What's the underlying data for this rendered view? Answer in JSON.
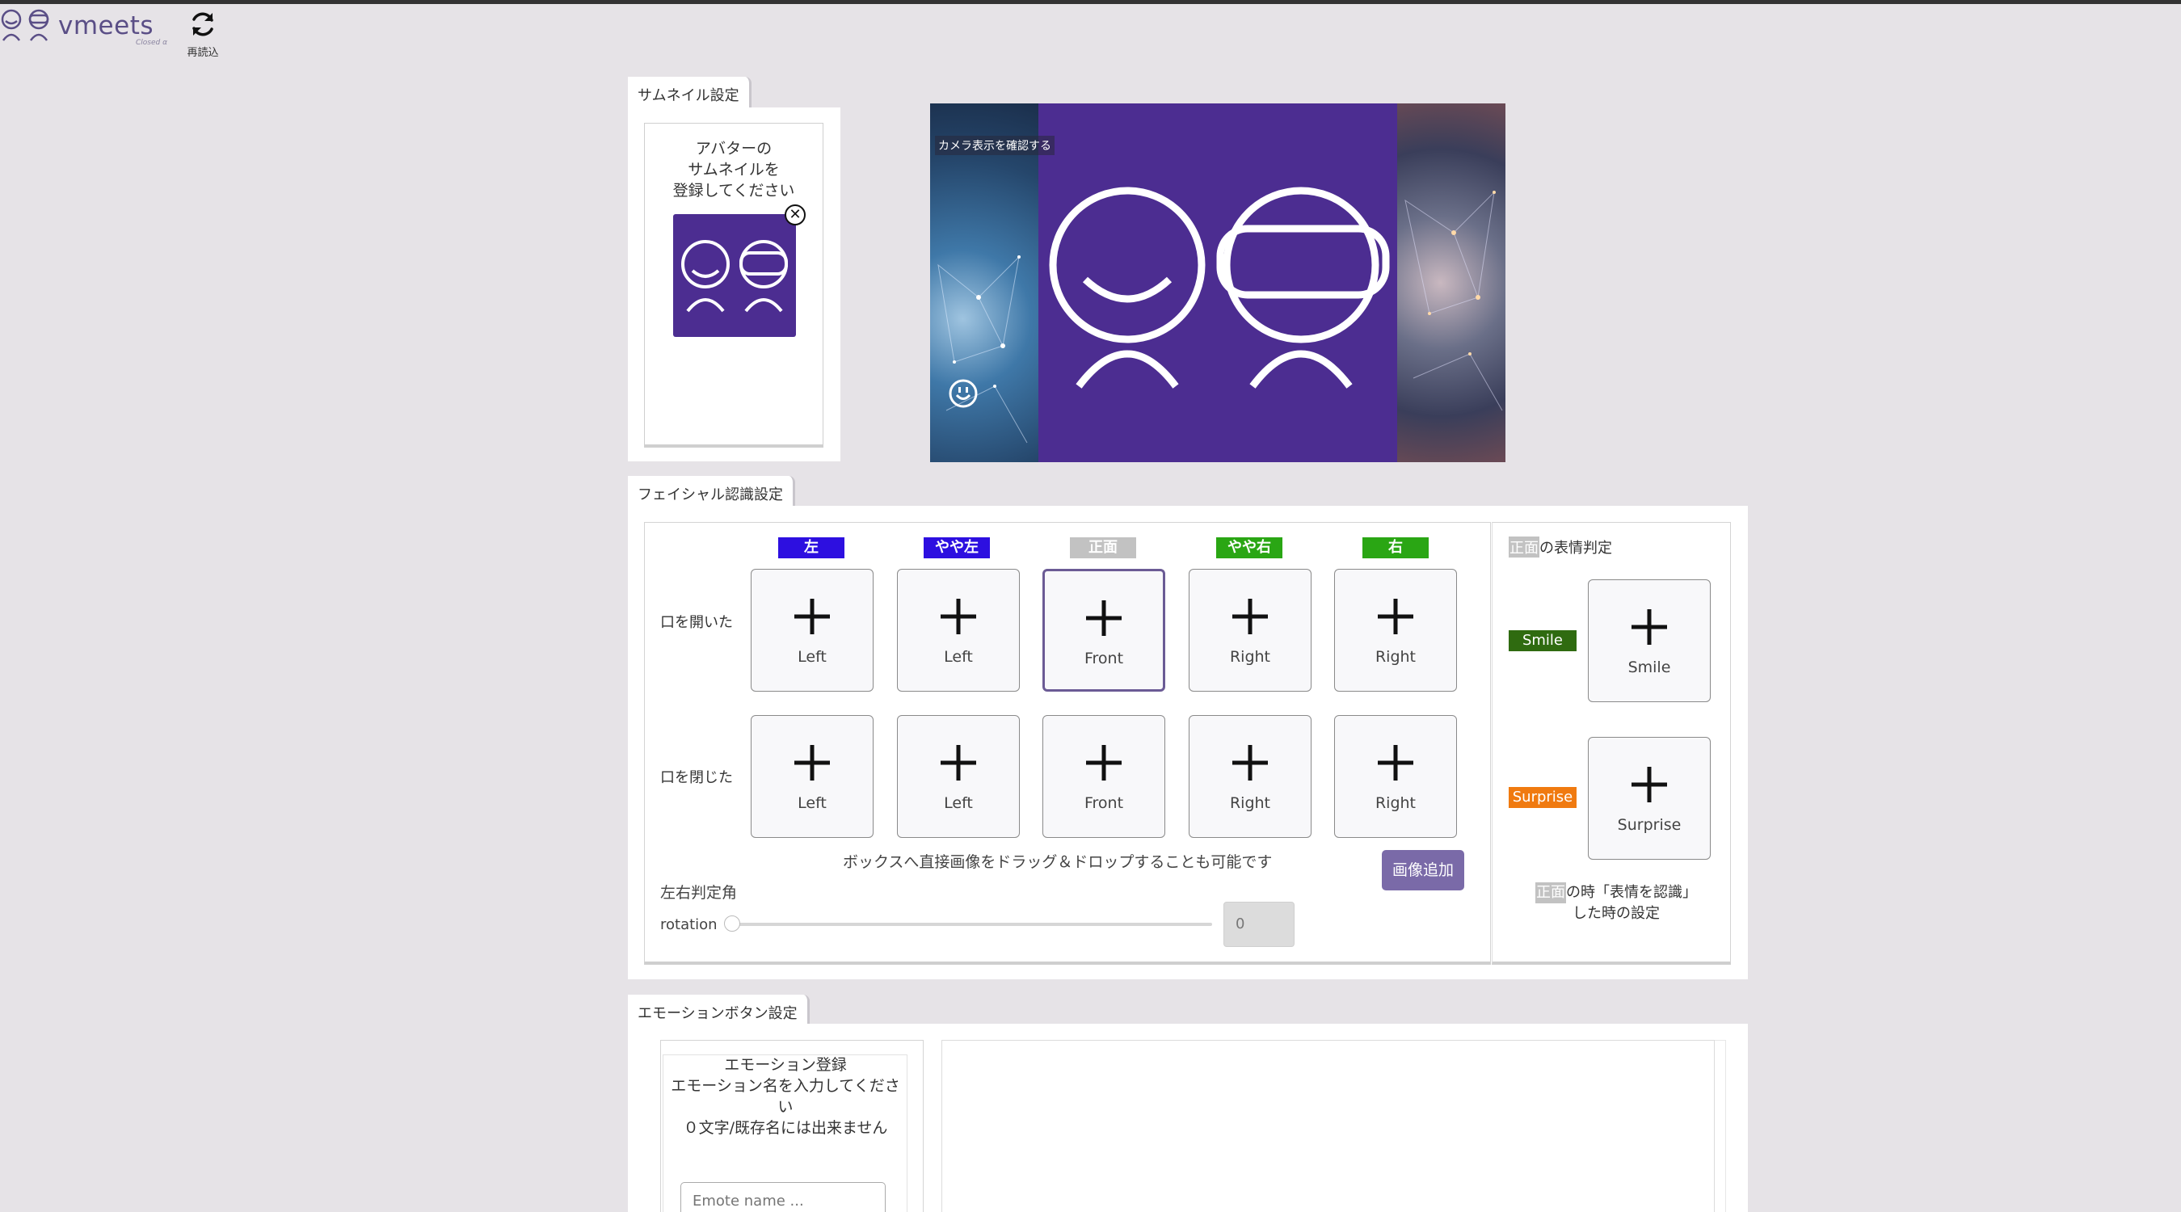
{
  "header": {
    "logo_text": "vmeets",
    "logo_sub": "Closed α",
    "reload_label": "再読込"
  },
  "thumbnail": {
    "tab_label": "サムネイル設定",
    "instruction_line1": "アバターの",
    "instruction_line2": "サムネイルを",
    "instruction_line3": "登録してください",
    "close_glyph": "✕"
  },
  "camera": {
    "label": "カメラ表示を確認する"
  },
  "facial": {
    "tab_label": "フェイシャル認識設定",
    "directions": [
      {
        "label": "左",
        "color": "#2d0fe0"
      },
      {
        "label": "やや左",
        "color": "#2d0fe0"
      },
      {
        "label": "正面",
        "color": "#c2c2c2"
      },
      {
        "label": "やや右",
        "color": "#2aa614"
      },
      {
        "label": "右",
        "color": "#2aa614"
      }
    ],
    "row_open": "口を開いた",
    "row_closed": "口を閉じた",
    "open_buttons": [
      "Left",
      "Left",
      "Front",
      "Right",
      "Right"
    ],
    "closed_buttons": [
      "Left",
      "Left",
      "Front",
      "Right",
      "Right"
    ],
    "dragdrop_hint": "ボックスへ直接画像をドラッグ＆ドロップすることも可能です",
    "add_image_label": "画像追加",
    "angle_label": "左右判定角",
    "rotation_label": "rotation",
    "rotation_value": "0"
  },
  "expression": {
    "front_word": "正面",
    "title_suffix": "の表情判定",
    "smile_tag": "Smile",
    "smile_tag_color": "#2f6b10",
    "smile_button": "Smile",
    "surprise_tag": "Surprise",
    "surprise_tag_color": "#f07a10",
    "surprise_button": "Surprise",
    "note_line1_suffix": "の時「表情を認識」",
    "note_line2": "した時の設定"
  },
  "emotion": {
    "tab_label": "エモーションボタン設定",
    "title": "エモーション登録",
    "instruction": "エモーション名を入力してください",
    "rule": "０文字/既存名には出来ません",
    "input_placeholder": "Emote name ..."
  }
}
